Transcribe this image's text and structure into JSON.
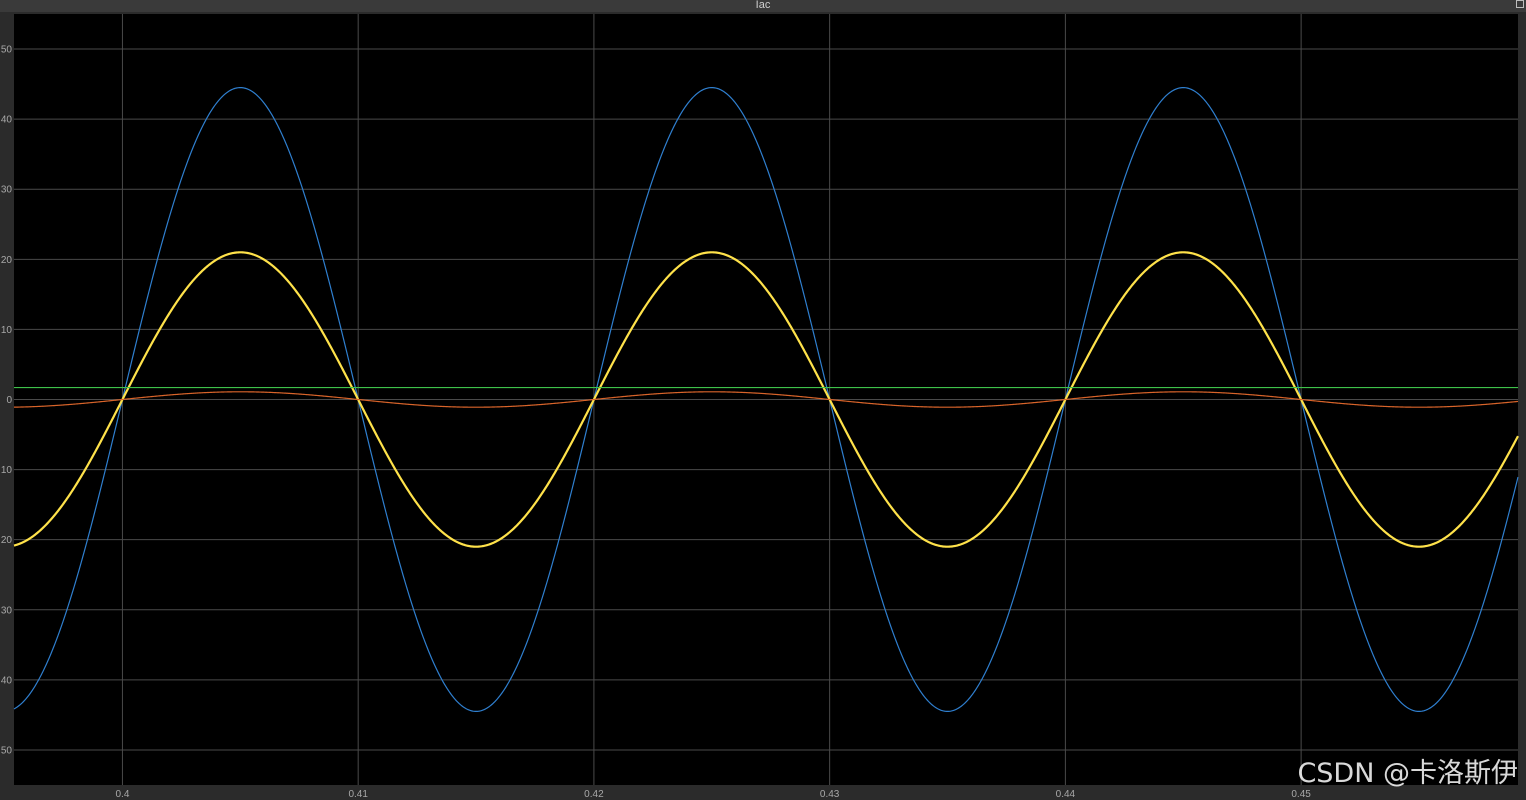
{
  "window": {
    "title": "Iac"
  },
  "colors": {
    "background": "#000000",
    "frame": "#2b2b2b",
    "grid": "#4a4a4a",
    "tick_text": "#a8a8a8"
  },
  "watermark": {
    "text": "CSDN @卡洛斯伊"
  },
  "chart_data": {
    "type": "line",
    "title": "Iac",
    "xlabel": "",
    "ylabel": "",
    "xlim": [
      0.3954,
      0.4592
    ],
    "ylim": [
      -55,
      55
    ],
    "grid": true,
    "x_ticks": [
      0.4,
      0.41,
      0.42,
      0.43,
      0.44,
      0.45
    ],
    "x_tick_labels": [
      "0.4",
      "0.41",
      "0.42",
      "0.43",
      "0.44",
      "0.45"
    ],
    "y_ticks": [
      50,
      40,
      30,
      20,
      10,
      0,
      -10,
      -20,
      -30,
      -40,
      -50
    ],
    "y_tick_labels": [
      "50",
      "40",
      "30",
      "20",
      "10",
      "0",
      "10",
      "20",
      "30",
      "40",
      "50"
    ],
    "series": [
      {
        "kind": "sine",
        "color": "#2f7fcf",
        "amplitude": 44.5,
        "frequency_hz": 50,
        "zero_crossing_x": 0.4,
        "offset": 0,
        "line_width": 1.2
      },
      {
        "kind": "sine",
        "color": "#ffe24a",
        "amplitude": 21,
        "frequency_hz": 50,
        "zero_crossing_x": 0.4,
        "offset": 0,
        "line_width": 2.2,
        "ripple_band": 0.6
      },
      {
        "kind": "sine",
        "color": "#d9642a",
        "amplitude": 1.1,
        "frequency_hz": 50,
        "zero_crossing_x": 0.4,
        "offset": 0,
        "line_width": 1.2
      },
      {
        "kind": "constant",
        "color": "#3ec24a",
        "value": 1.7,
        "line_width": 1.1
      }
    ]
  }
}
